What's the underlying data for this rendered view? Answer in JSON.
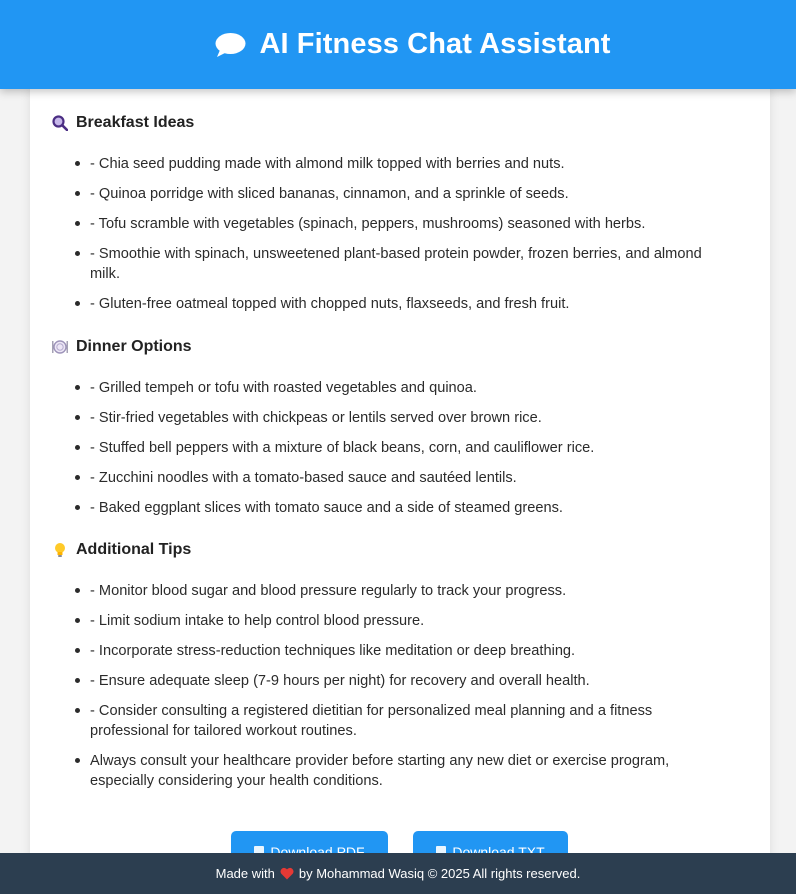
{
  "header": {
    "title": "AI Fitness Chat Assistant",
    "icon": "chat-bubble-icon"
  },
  "sections": [
    {
      "icon": "magnifier-icon",
      "title": "Breakfast Ideas",
      "items": [
        "- Chia seed pudding made with almond milk topped with berries and nuts.",
        "- Quinoa porridge with sliced bananas, cinnamon, and a sprinkle of seeds.",
        "- Tofu scramble with vegetables (spinach, peppers, mushrooms) seasoned with herbs.",
        "- Smoothie with spinach, unsweetened plant-based protein powder, frozen berries, and almond milk.",
        "- Gluten-free oatmeal topped with chopped nuts, flaxseeds, and fresh fruit."
      ]
    },
    {
      "icon": "plate-icon",
      "title": "Dinner Options",
      "items": [
        "- Grilled tempeh or tofu with roasted vegetables and quinoa.",
        "- Stir-fried vegetables with chickpeas or lentils served over brown rice.",
        "- Stuffed bell peppers with a mixture of black beans, corn, and cauliflower rice.",
        "- Zucchini noodles with a tomato-based sauce and sautéed lentils.",
        "- Baked eggplant slices with tomato sauce and a side of steamed greens."
      ]
    },
    {
      "icon": "lightbulb-icon",
      "title": "Additional Tips",
      "items": [
        "- Monitor blood sugar and blood pressure regularly to track your progress.",
        "- Limit sodium intake to help control blood pressure.",
        "- Incorporate stress-reduction techniques like meditation or deep breathing.",
        "- Ensure adequate sleep (7-9 hours per night) for recovery and overall health.",
        "- Consider consulting a registered dietitian for personalized meal planning and a fitness professional for tailored workout routines.",
        "Always consult your healthcare provider before starting any new diet or exercise program, especially considering your health conditions."
      ]
    }
  ],
  "buttons": {
    "pdf_label": "Download PDF",
    "txt_label": "Download TXT"
  },
  "footer": {
    "prefix": "Made with",
    "suffix": "by Mohammad Wasiq © 2025 All rights reserved.",
    "heart_color": "#e53935"
  },
  "colors": {
    "accent": "#2196f3",
    "footer_bg": "#2c3e50"
  }
}
